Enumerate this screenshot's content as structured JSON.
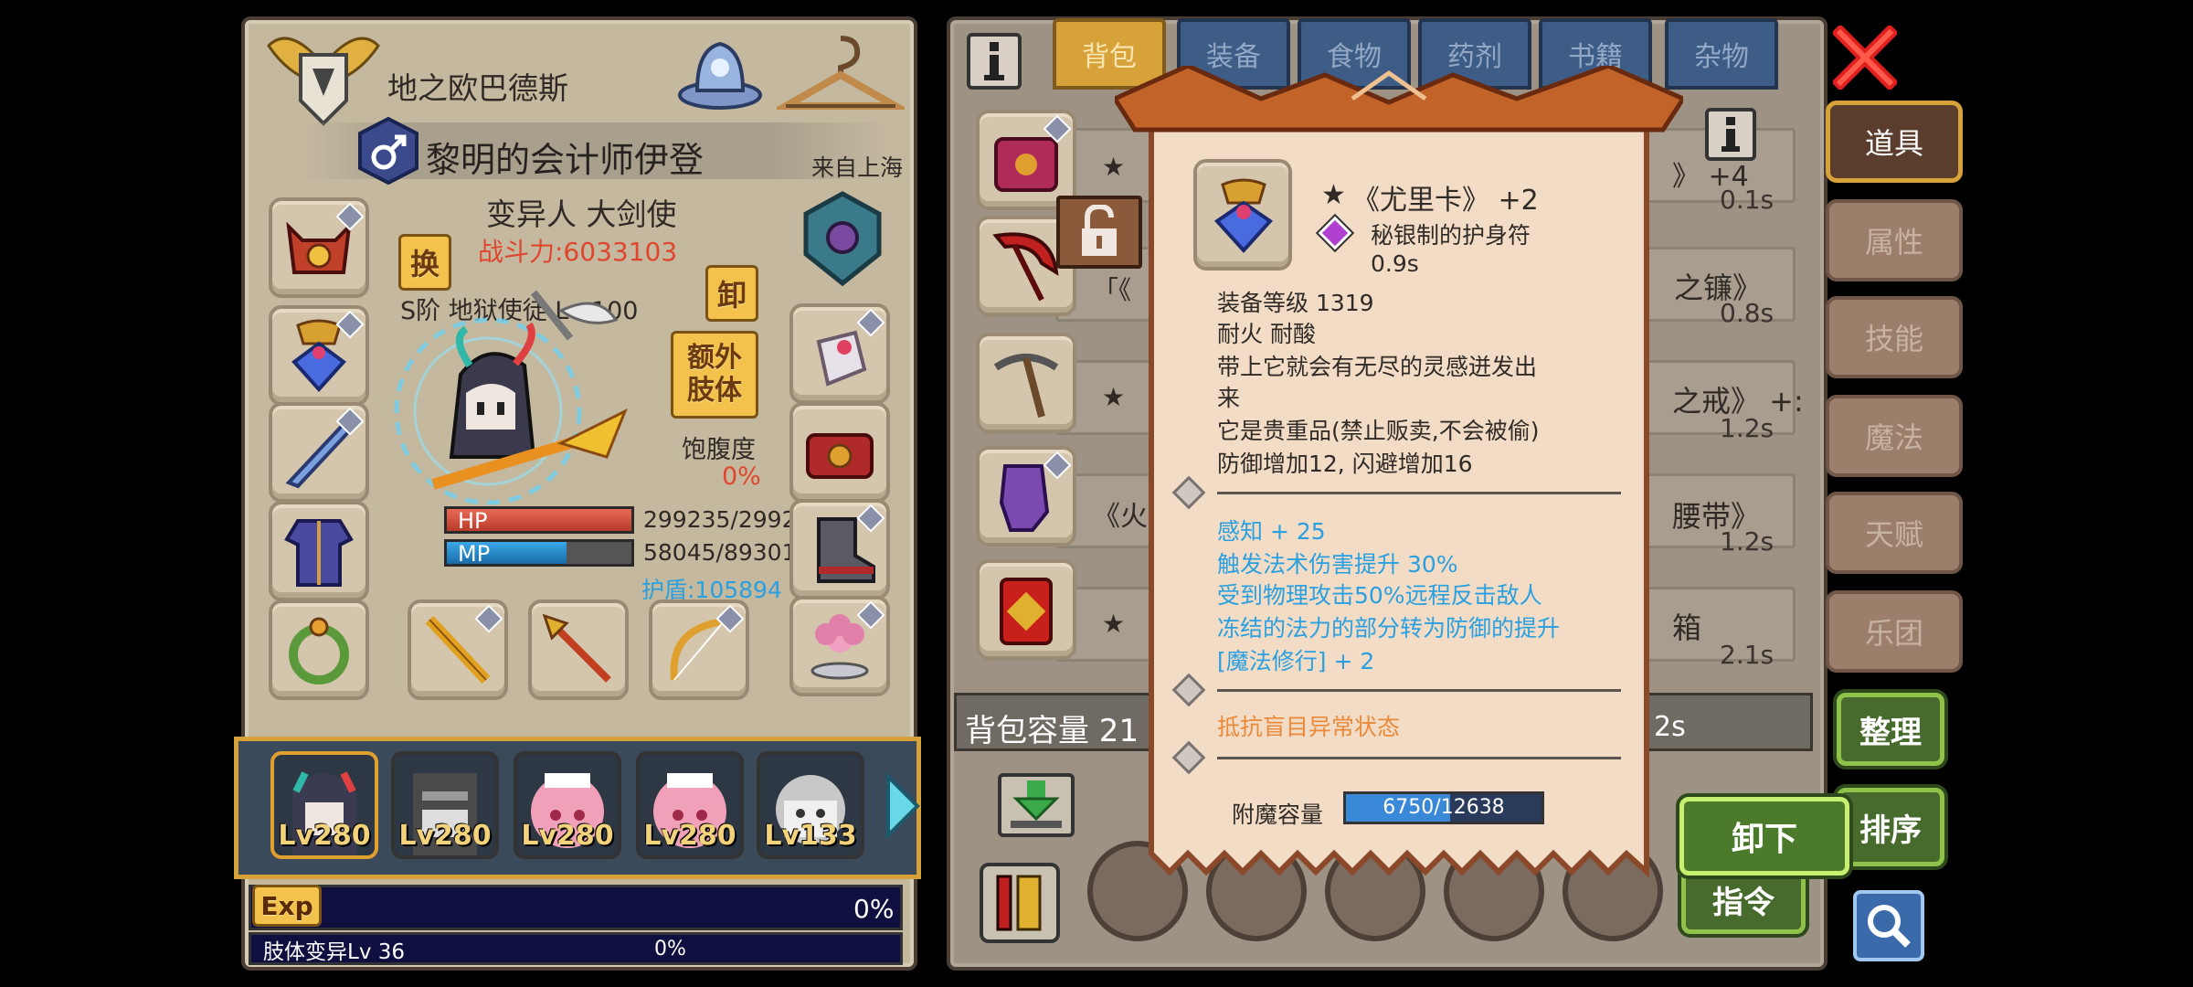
{
  "character": {
    "title_rank": "地之欧巴德斯",
    "name": "黎明的会计师伊登",
    "origin": "来自上海",
    "class": "变异人 大剑使",
    "power": "战斗力:6033103",
    "swap_label": "换",
    "unequip_label": "卸",
    "extra_limb_label": "额外肢体",
    "job": "S阶 地狱使徒 Lv 100",
    "satiety_label": "饱腹度",
    "satiety_value": "0%",
    "hp_label": "HP",
    "hp_value": "299235/2992",
    "hp_fraction": 1.0,
    "mp_label": "MP",
    "mp_value": "58045/89301",
    "mp_fraction": 0.65,
    "shield": "护盾:105894"
  },
  "party": [
    {
      "level": "Lv280"
    },
    {
      "level": "Lv280"
    },
    {
      "level": "Lv280"
    },
    {
      "level": "Lv280"
    },
    {
      "level": "Lv133"
    }
  ],
  "exp": {
    "label": "Exp",
    "percent": "0%",
    "fraction": 0.0,
    "mutation_label": "肢体变异Lv 36",
    "mutation_percent": "0%"
  },
  "inventory": {
    "tabs": [
      "背包",
      "装备",
      "食物",
      "药剂",
      "书籍",
      "杂物"
    ],
    "active_tab": 0,
    "capacity_label": "背包容量 21",
    "rows": [
      {
        "fragment": "★",
        "suffix": "》 +4",
        "time": "0.1s"
      },
      {
        "fragment": "「《",
        "suffix": "之镰》",
        "time": "0.8s"
      },
      {
        "fragment": "★",
        "suffix": "之戒》 +:",
        "time": "1.2s"
      },
      {
        "fragment": "《火",
        "suffix": "腰带》",
        "time": "1.2s"
      },
      {
        "fragment": "★",
        "suffix": "箱",
        "time": "2.1s"
      }
    ],
    "bottom_time": "2s"
  },
  "side_tabs": [
    "道具",
    "属性",
    "技能",
    "魔法",
    "天赋",
    "乐团"
  ],
  "actions": {
    "sort": "整理",
    "order": "排序",
    "unequip": "卸下",
    "command": "指令"
  },
  "tooltip": {
    "star": "★",
    "item_name": "《尤里卡》 +2",
    "material": "秘银制的护身符",
    "time": "0.9s",
    "equip_level": "装备等级 1319",
    "resist": "耐火 耐酸",
    "lore_1": "带上它就会有无尽的灵感迸发出",
    "lore_2": "来",
    "precious": "它是贵重品(禁止贩卖,不会被偷)",
    "defense": "防御增加12, 闪避增加16",
    "bonuses": [
      "感知 + 25",
      "触发法术伤害提升 30%",
      "受到物理攻击50%远程反击敌人",
      "冻结的法力的部分转为防御的提升",
      "[魔法修行] + 2"
    ],
    "special": "抵抗盲目异常状态",
    "enchant_label": "附魔容量",
    "enchant_value": "6750/12638",
    "enchant_fraction": 0.534
  },
  "colors": {
    "panel_bg": "#c4b89f",
    "power_red": "#e0462e",
    "blue_text": "#2aa0e0",
    "orange_text": "#e88a3a",
    "tab_active": "#d8a23a",
    "tab_inactive": "#3d5c86"
  }
}
